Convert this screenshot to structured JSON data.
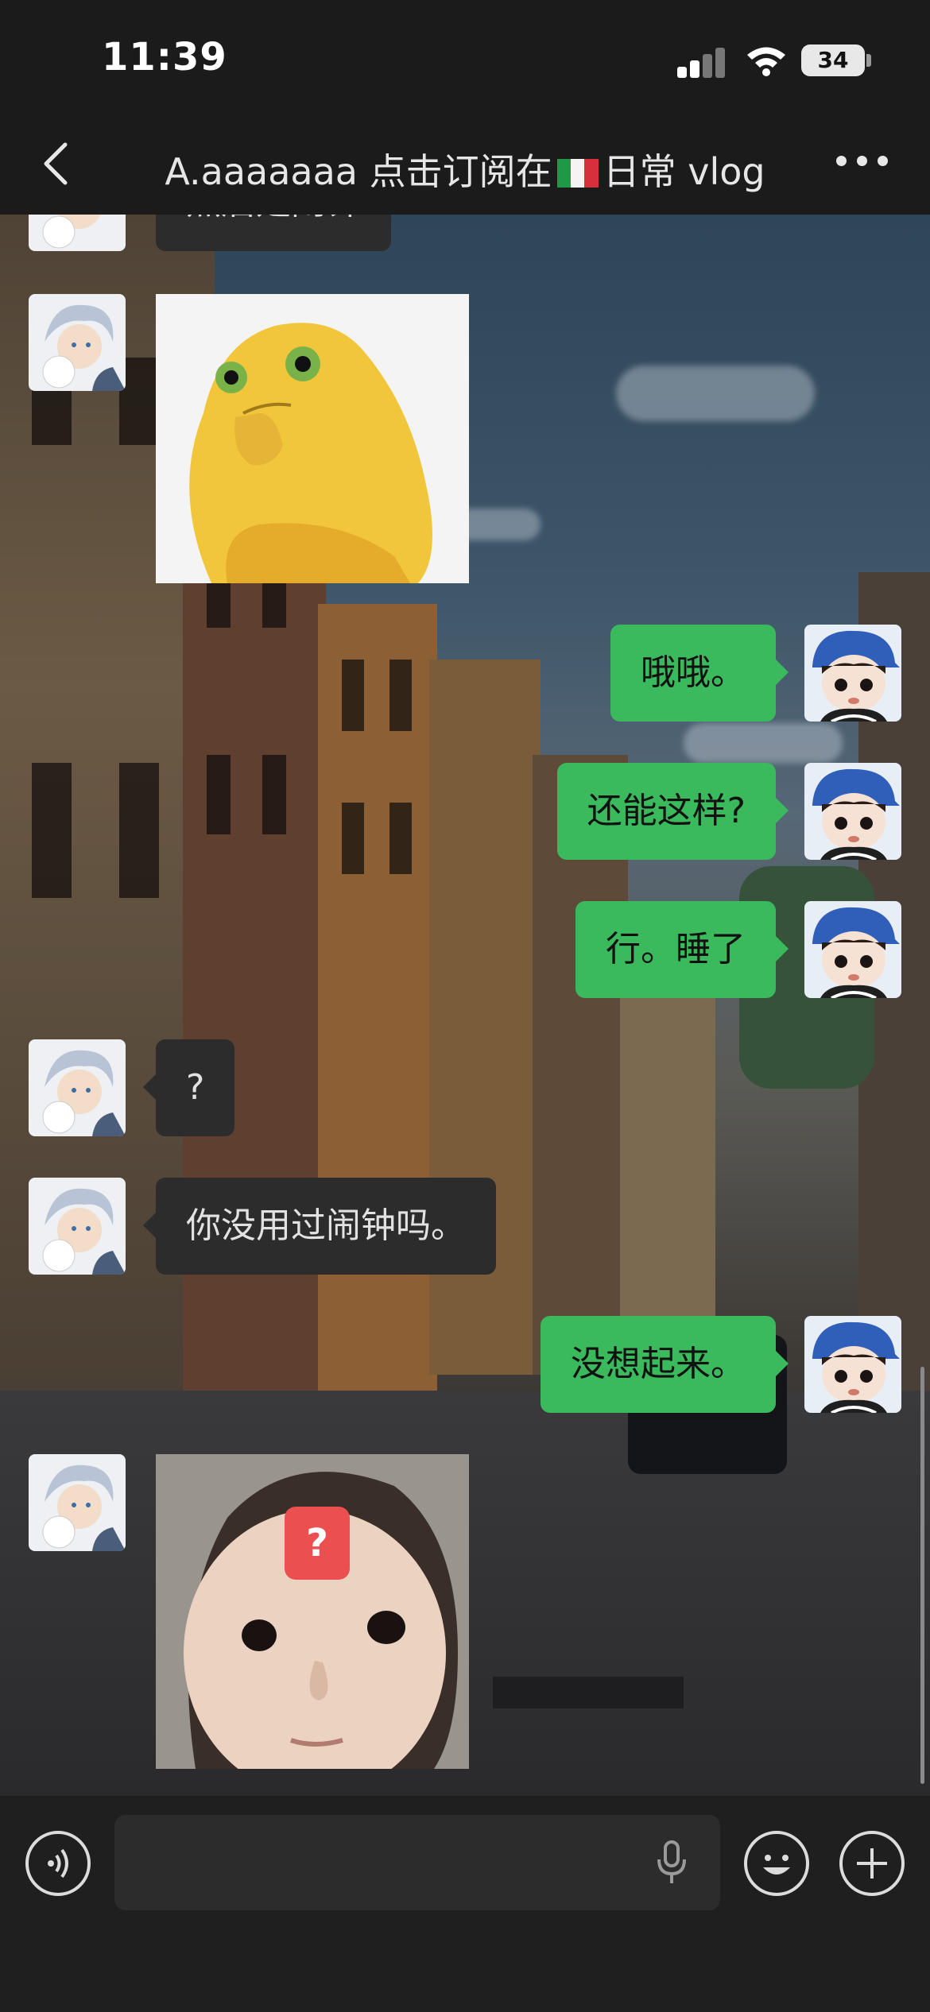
{
  "status_bar": {
    "time": "11:39",
    "battery": "34"
  },
  "nav": {
    "title_prefix": "A.aaaaaaa 点击订阅在",
    "title_suffix": "日常 vlog",
    "flag": "italy-flag"
  },
  "messages": [
    {
      "side": "in",
      "type": "text",
      "text": "然后是闹钟"
    },
    {
      "side": "in",
      "type": "sticker",
      "sticker": "yellow-frog-thinking"
    },
    {
      "side": "out",
      "type": "text",
      "text": "哦哦。"
    },
    {
      "side": "out",
      "type": "text",
      "text": "还能这样?"
    },
    {
      "side": "out",
      "type": "text",
      "text": "行。睡了"
    },
    {
      "side": "in",
      "type": "text",
      "text": "?"
    },
    {
      "side": "in",
      "type": "text",
      "text": "你没用过闹钟吗。"
    },
    {
      "side": "out",
      "type": "text",
      "text": "没想起来。"
    },
    {
      "side": "in",
      "type": "sticker",
      "sticker": "baby-face-question",
      "badge": "?"
    }
  ],
  "input_bar": {
    "icons": [
      "voice-icon",
      "microphone-icon",
      "emoji-icon",
      "plus-icon"
    ]
  },
  "colors": {
    "outgoing_bubble": "#3aba5c",
    "incoming_bubble": "#2c2c2c",
    "bar_bg": "#1b1b1b"
  }
}
